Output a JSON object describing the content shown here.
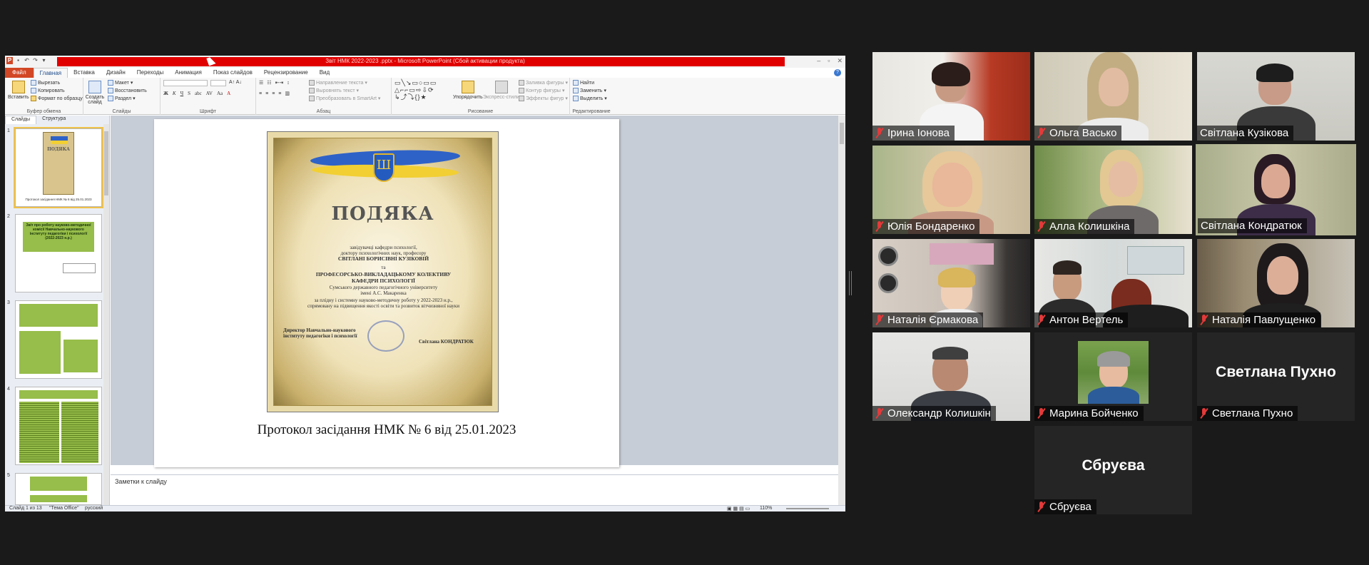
{
  "powerpoint": {
    "window_title": "Звіт НМК 2022-2023 .pptx - Microsoft PowerPoint (Сбой активации продукта)",
    "tabs": [
      "Файл",
      "Главная",
      "Вставка",
      "Дизайн",
      "Переходы",
      "Анимация",
      "Показ слайдов",
      "Рецензирование",
      "Вид"
    ],
    "ribbon": {
      "clipboard": {
        "paste": "Вставить",
        "cut": "Вырезать",
        "copy": "Копировать",
        "format_painter": "Формат по образцу",
        "group": "Буфер обмена"
      },
      "slides": {
        "new_slide": "Создать слайд",
        "layout": "Макет",
        "reset": "Восстановить",
        "section": "Раздел",
        "group": "Слайды"
      },
      "font": {
        "group": "Шрифт"
      },
      "paragraph": {
        "text_direction": "Направление текста",
        "align_text": "Выровнять текст",
        "smartart": "Преобразовать в SmartArt",
        "group": "Абзац"
      },
      "drawing": {
        "arrange": "Упорядочить",
        "quick_styles": "Экспресс-стили",
        "fill": "Заливка фигуры",
        "outline": "Контур фигуры",
        "effects": "Эффекты фигур",
        "group": "Рисование"
      },
      "editing": {
        "find": "Найти",
        "replace": "Заменить",
        "select": "Выделить",
        "group": "Редактирование"
      }
    },
    "pane_tabs": [
      "Слайды",
      "Структура"
    ],
    "thumbnails": {
      "s1_caption": "Протокол засідання НМК № 6 від 25.01.2023",
      "s2_title": "Звіт про роботу науково-методичної комісії Навчально-наукового інституту педагогіки і психології (2022-2023 н.р.)"
    },
    "slide": {
      "cert_heading": "ПОДЯКА",
      "cert_lines": [
        "завідувачці кафедри психології,",
        "доктору психологічних наук, професору",
        "СВІТЛАНІ БОРИСІВНІ КУЗІКОВІЙ",
        "та",
        "ПРОФЕСОРСЬКО-ВИКЛАДАЦЬКОМУ КОЛЕКТИВУ",
        "КАФЕДРИ ПСИХОЛОГІЇ",
        "Сумського державного педагогічного університету",
        "імені А.С. Макаренка",
        "за плідну і системну науково-методичну роботу у 2022-2023 н.р.,",
        "спрямовану на підвищення якості освіти та розвиток вітчизняної науки"
      ],
      "cert_signer_left": "Директор Навчально-наукового інституту педагогіки і психології",
      "cert_signer_right": "Світлана КОНДРАТЮК",
      "caption": "Протокол засідання НМК № 6 від 25.01.2023"
    },
    "notes_placeholder": "Заметки к слайду",
    "status": {
      "slide": "Слайд 1 из 13",
      "theme": "\"Тема Office\"",
      "lang": "русский",
      "zoom": "110%"
    }
  },
  "participants": [
    {
      "name": "Ірина Іонова",
      "muted": true
    },
    {
      "name": "Ольга Васько",
      "muted": true
    },
    {
      "name": "Світлана Кузікова",
      "muted": false
    },
    {
      "name": "Юлія Бондаренко",
      "muted": true
    },
    {
      "name": "Алла Колишкіна",
      "muted": true
    },
    {
      "name": "Світлана Кондратюк",
      "muted": false,
      "active_speaker": true
    },
    {
      "name": "Наталія  Єрмакова",
      "muted": true
    },
    {
      "name": "Антон Вертель",
      "muted": true
    },
    {
      "name": "Наталія Павлущенко",
      "muted": true
    },
    {
      "name": "Олександр Колишкін",
      "muted": true
    },
    {
      "name": "Марина Бойченко",
      "muted": true
    },
    {
      "name": "Светлана Пухно",
      "muted": true,
      "video_off": true,
      "display": "Светлана Пухно"
    },
    {
      "name": "Сбруєва",
      "muted": true,
      "video_off": true,
      "display": "Сбруєва"
    }
  ],
  "colors": {
    "ppt_accent": "#d24726",
    "active_speaker_border": "#d8e05a",
    "muted_red": "#e23a3a",
    "slide_green": "#97bd4a"
  }
}
